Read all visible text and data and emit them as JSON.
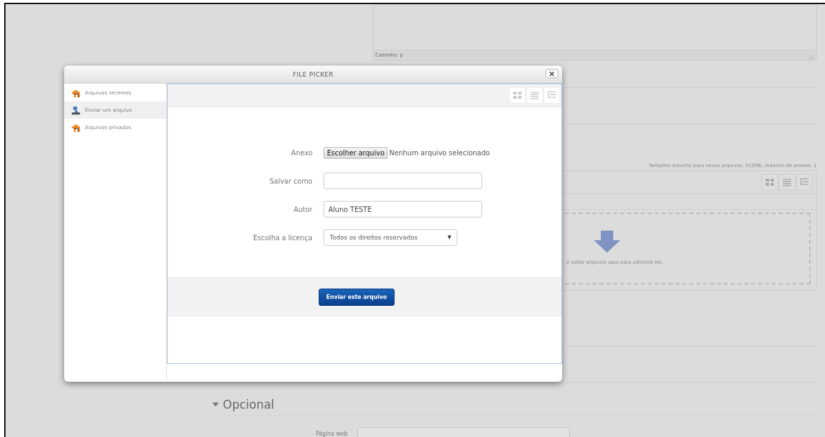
{
  "page": {
    "editor_path": "Caminho: p",
    "filemanager": {
      "limits": "Tamanho máximo para novos arquivos: 512Mb, máximo de anexos: 1",
      "drop_hint": "e soltar arquivos aqui para adicioná-los."
    },
    "section": {
      "title": "Opcional",
      "expanded": true
    },
    "field_label": "Página web"
  },
  "dialog": {
    "title": "FILE PICKER",
    "sidebar": {
      "items": [
        {
          "label": "Arquivos recentes",
          "kind": "repository",
          "selected": false
        },
        {
          "label": "Enviar um arquivo",
          "kind": "upload",
          "selected": true
        },
        {
          "label": "Arquivos privados",
          "kind": "repository",
          "selected": false
        }
      ]
    },
    "form": {
      "attachment": {
        "label": "Anexo",
        "button": "Escolher arquivo",
        "status": "Nenhum arquivo selecionado"
      },
      "save_as": {
        "label": "Salvar como"
      },
      "author": {
        "label": "Autor",
        "value": "Aluno TESTE"
      },
      "license": {
        "label": "Escolha a licença",
        "value": "Todos os direitos reservados"
      },
      "submit": "Enviar este arquivo"
    }
  }
}
